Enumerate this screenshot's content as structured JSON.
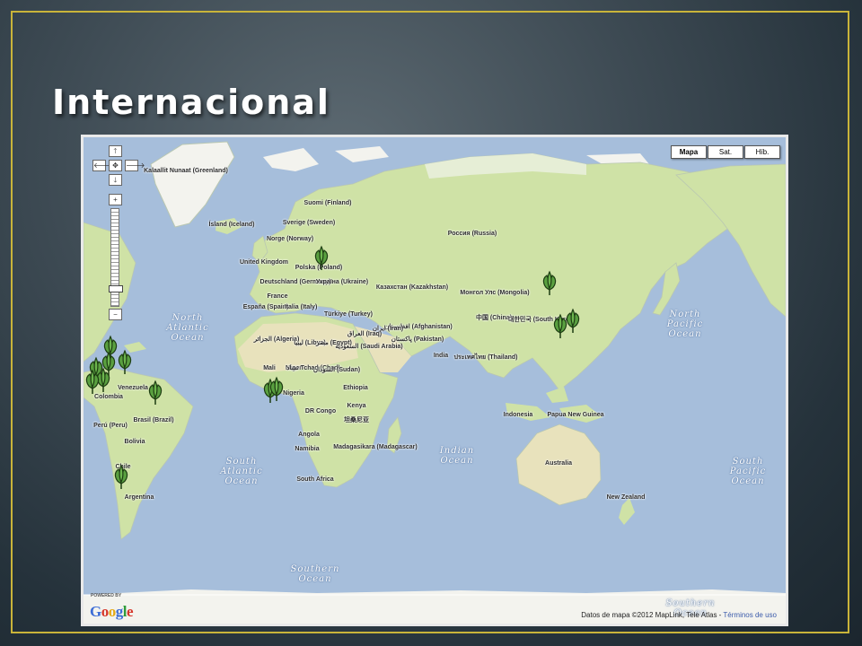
{
  "slide": {
    "title": "Internacional"
  },
  "map": {
    "type_buttons": [
      "Mapa",
      "Sat.",
      "Híb."
    ],
    "active_type": "Mapa",
    "nav_icons": {
      "up": "arrow-up-icon",
      "left": "arrow-left-icon",
      "center": "center-icon",
      "right": "arrow-right-icon",
      "down": "arrow-down-icon",
      "zoom_in": "zoom-in-icon",
      "zoom_out": "zoom-out-icon"
    },
    "nav_glyphs": {
      "up": "🡑",
      "left": "🡐",
      "center": "✥",
      "right": "🡒",
      "down": "🡓",
      "zoom_in": "+",
      "zoom_out": "−"
    },
    "powered_by": "POWERED BY",
    "logo_text": "Google",
    "attribution": "Datos de mapa ©2012 MapLink, Tele Atlas - ",
    "terms_link": "Términos de uso",
    "colors": {
      "ocean": "#a6bedb",
      "land": "#cfe2a6",
      "ice": "#f3f3ee",
      "desert": "#e8e2bc",
      "marker": "#5aa040"
    },
    "countries": [
      {
        "name": "Kalaallit Nunaat (Greenland)"
      },
      {
        "name": "Ísland (Iceland)"
      },
      {
        "name": "Suomi (Finland)"
      },
      {
        "name": "Sverige (Sweden)"
      },
      {
        "name": "Norge (Norway)"
      },
      {
        "name": "United Kingdom"
      },
      {
        "name": "Polska (Poland)"
      },
      {
        "name": "Deutschland (Germany)"
      },
      {
        "name": "Україна (Ukraine)"
      },
      {
        "name": "France"
      },
      {
        "name": "España (Spain)"
      },
      {
        "name": "Italia (Italy)"
      },
      {
        "name": "Türkiye (Turkey)"
      },
      {
        "name": "Россия (Russia)"
      },
      {
        "name": "Казахстан (Kazakhstan)"
      },
      {
        "name": "Монгол Улс (Mongolia)"
      },
      {
        "name": "中国 (China)"
      },
      {
        "name": "대한민국 (South Korea)"
      },
      {
        "name": "افغانستان (Afghanistan)"
      },
      {
        "name": "ایران (Iran)"
      },
      {
        "name": "پاکستان (Pakistan)"
      },
      {
        "name": "العراق (Iraq)"
      },
      {
        "name": "السعودية (Saudi Arabia)"
      },
      {
        "name": "India"
      },
      {
        "name": "ประเทศไทย (Thailand)"
      },
      {
        "name": "الجزائر (Algeria)"
      },
      {
        "name": "ليبيا (Libya)"
      },
      {
        "name": "مصر (Egypt)"
      },
      {
        "name": "Mali"
      },
      {
        "name": "Niger"
      },
      {
        "name": "تشاد Tchad (Chad)"
      },
      {
        "name": "السودان (Sudan)"
      },
      {
        "name": "Ethiopia"
      },
      {
        "name": "Nigeria"
      },
      {
        "name": "DR Congo"
      },
      {
        "name": "Kenya"
      },
      {
        "name": "坦桑尼亚"
      },
      {
        "name": "Angola"
      },
      {
        "name": "Namibia"
      },
      {
        "name": "Madagasikara (Madagascar)"
      },
      {
        "name": "South Africa"
      },
      {
        "name": "Indonesia"
      },
      {
        "name": "Papua New Guinea"
      },
      {
        "name": "Australia"
      },
      {
        "name": "New Zealand"
      },
      {
        "name": "Venezuela"
      },
      {
        "name": "Colombia"
      },
      {
        "name": "Perú (Peru)"
      },
      {
        "name": "Brasil (Brazil)"
      },
      {
        "name": "Bolivia"
      },
      {
        "name": "Chile"
      },
      {
        "name": "Argentina"
      }
    ],
    "oceans": [
      {
        "name": "North Atlantic Ocean"
      },
      {
        "name": "South Atlantic Ocean"
      },
      {
        "name": "Indian Ocean"
      },
      {
        "name": "North Pacific Ocean"
      },
      {
        "name": "South Pacific Ocean"
      },
      {
        "name": "Southern Ocean"
      },
      {
        "name": "Southern Ocean"
      }
    ],
    "markers": [
      {
        "location": "Poland"
      },
      {
        "location": "Northeast China"
      },
      {
        "location": "South Korea"
      },
      {
        "location": "Japan"
      },
      {
        "location": "Nigeria"
      },
      {
        "location": "Ghana"
      },
      {
        "location": "Mexico"
      },
      {
        "location": "Central America"
      },
      {
        "location": "Caribbean"
      },
      {
        "location": "Colombia"
      },
      {
        "location": "Venezuela"
      },
      {
        "location": "Brazil"
      },
      {
        "location": "Chile"
      }
    ]
  }
}
